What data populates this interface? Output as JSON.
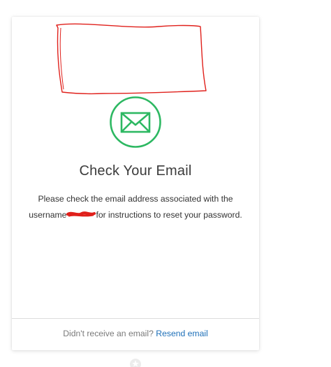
{
  "card": {
    "title": "Check Your Email",
    "message_part1": "Please check the email address associated with the username",
    "message_part2": "for instructions to reset your password.",
    "footer_prompt": "Didn't receive an email?",
    "footer_link": "Resend email"
  },
  "icons": {
    "mail": "mail-icon",
    "below": "star-icon"
  },
  "colors": {
    "accent_green": "#2db862",
    "link_blue": "#1d6fb8",
    "redaction_red": "#e0201b"
  }
}
